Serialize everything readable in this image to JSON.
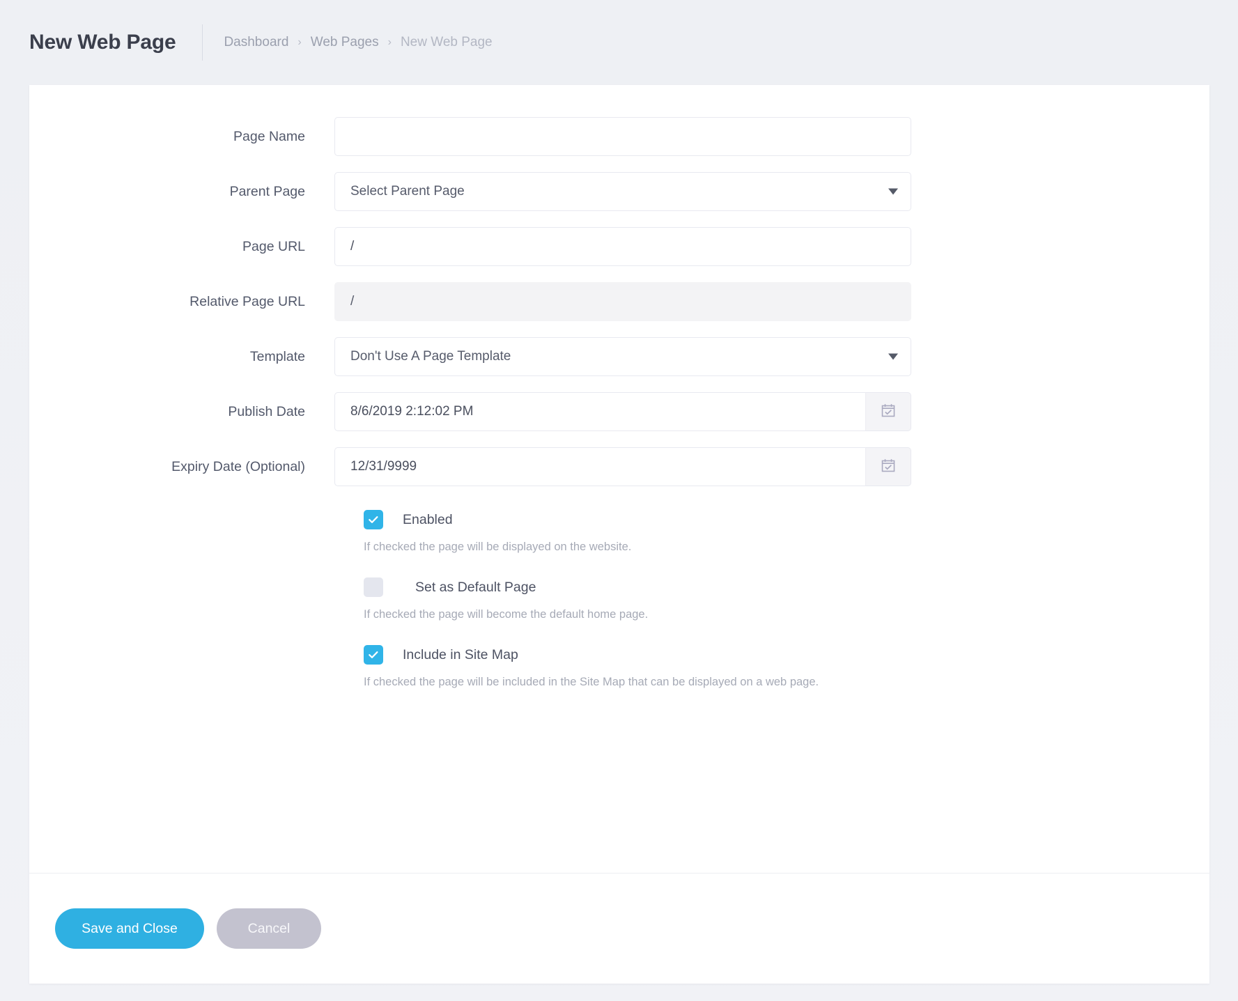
{
  "header": {
    "title": "New Web Page",
    "breadcrumb": [
      {
        "label": "Dashboard"
      },
      {
        "label": "Web Pages"
      },
      {
        "label": "New Web Page"
      }
    ],
    "breadcrumb_separator": "›"
  },
  "form": {
    "page_name": {
      "label": "Page Name",
      "value": "",
      "placeholder": ""
    },
    "parent_page": {
      "label": "Parent Page",
      "selected": "Select Parent Page",
      "arrow_icon": "chevron-down-icon"
    },
    "page_url": {
      "label": "Page URL",
      "value": "/"
    },
    "relative_page_url": {
      "label": "Relative Page URL",
      "value": "/",
      "readonly": true
    },
    "template": {
      "label": "Template",
      "selected": "Don't Use A Page Template",
      "arrow_icon": "chevron-down-icon"
    },
    "publish_date": {
      "label": "Publish Date",
      "value": "8/6/2019 2:12:02 PM",
      "button_icon": "calendar-check-icon"
    },
    "expiry_date": {
      "label": "Expiry Date (Optional)",
      "value": "12/31/9999",
      "button_icon": "calendar-check-icon"
    }
  },
  "checkboxes": [
    {
      "name": "enabled",
      "label": "Enabled",
      "checked": true,
      "help": "If checked the page will be displayed on the website."
    },
    {
      "name": "set-as-default-page",
      "label": "Set as Default Page",
      "checked": false,
      "help": "If checked the page will become the default home page."
    },
    {
      "name": "include-in-site-map",
      "label": "Include in Site Map",
      "checked": true,
      "help": "If checked the page will be included in the Site Map that can be displayed on a web page."
    }
  ],
  "footer": {
    "save_label": "Save and Close",
    "cancel_label": "Cancel"
  },
  "colors": {
    "accent_blue": "#2fb0e2",
    "checkbox_blue": "#30b4e8",
    "cancel_grey": "#c3c2cf",
    "page_background": "#f0f1f5",
    "card_background": "#ffffff",
    "label_text": "#53596b",
    "help_text": "#a6aab6"
  }
}
